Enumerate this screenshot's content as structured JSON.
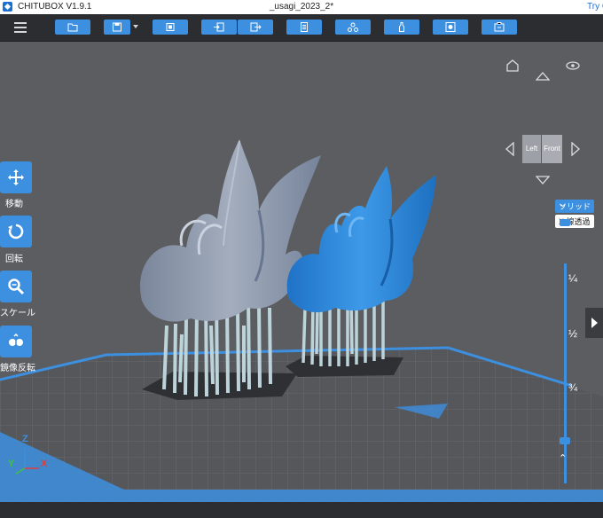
{
  "titlebar": {
    "app_name": "CHITUBOX V1.9.1",
    "file_name": "_usagi_2023_2*",
    "try_text": "Try C"
  },
  "toolbar": {
    "buttons": [
      {
        "name": "open-file-button",
        "icon": "folder-icon"
      },
      {
        "name": "save-button",
        "icon": "save-icon",
        "dropdown": true
      },
      {
        "name": "auto-layout-button",
        "icon": "layout-icon"
      },
      {
        "name": "import-button",
        "icon": "import-icon"
      },
      {
        "name": "export-button",
        "icon": "export-icon"
      },
      {
        "name": "hollow-button",
        "icon": "document-icon"
      },
      {
        "name": "support-button",
        "icon": "support-icon"
      },
      {
        "name": "settings-button",
        "icon": "bottle-icon"
      },
      {
        "name": "print-settings-button",
        "icon": "frame-icon"
      },
      {
        "name": "slice-button",
        "icon": "slice-icon"
      }
    ]
  },
  "left_tools": [
    {
      "label": "移動",
      "icon": "move-icon"
    },
    {
      "label": "回転",
      "icon": "rotate-icon"
    },
    {
      "label": "スケール",
      "icon": "scale-icon"
    },
    {
      "label": "鏡像反転",
      "icon": "mirror-icon"
    }
  ],
  "view_cube": {
    "left_label": "Left",
    "front_label": "Front"
  },
  "render_modes": {
    "solid": "ソリッド",
    "xray": "X 線透過"
  },
  "slider": {
    "marks": [
      "¼",
      "½",
      "¾"
    ]
  },
  "axes": {
    "z": "Z",
    "y": "Y",
    "x": "X"
  },
  "colors": {
    "accent": "#3d8fe0",
    "model_gray": "#8c98ab",
    "model_blue": "#2e86da",
    "support": "#b9d0d8",
    "platform_outline": "#3d8fe0"
  }
}
